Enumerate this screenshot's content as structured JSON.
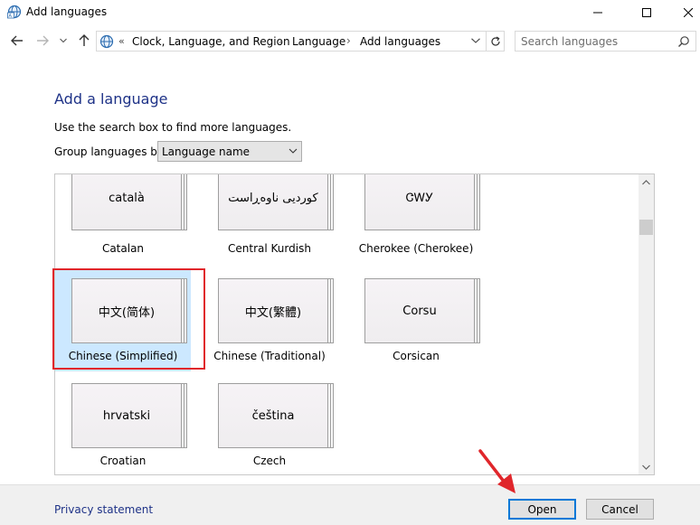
{
  "window": {
    "title": "Add languages"
  },
  "address": {
    "overflow": "«",
    "crumbs": [
      "Clock, Language, and Region",
      "Language",
      "Add languages"
    ],
    "separator": "›"
  },
  "search": {
    "placeholder": "Search languages"
  },
  "main": {
    "heading": "Add a language",
    "hint": "Use the search box to find more languages.",
    "group_label": "Group languages by:",
    "group_value": "Language name"
  },
  "languages": [
    {
      "native": "català",
      "name": "Catalan"
    },
    {
      "native": "کوردیی ناوەڕاست",
      "name": "Central Kurdish"
    },
    {
      "native": "ᏣᎳᎩ",
      "name": "Cherokee (Cherokee)"
    },
    {
      "native": "中文(简体)",
      "name": "Chinese (Simplified)",
      "selected": true
    },
    {
      "native": "中文(繁體)",
      "name": "Chinese (Traditional)"
    },
    {
      "native": "Corsu",
      "name": "Corsican"
    },
    {
      "native": "hrvatski",
      "name": "Croatian"
    },
    {
      "native": "čeština",
      "name": "Czech"
    }
  ],
  "footer": {
    "privacy": "Privacy statement",
    "open": "Open",
    "cancel": "Cancel"
  },
  "colors": {
    "heading": "#1e3287",
    "selected_tile": "#cce8ff",
    "highlight": "#e0262b",
    "footer_bg": "#f0f0f0"
  }
}
